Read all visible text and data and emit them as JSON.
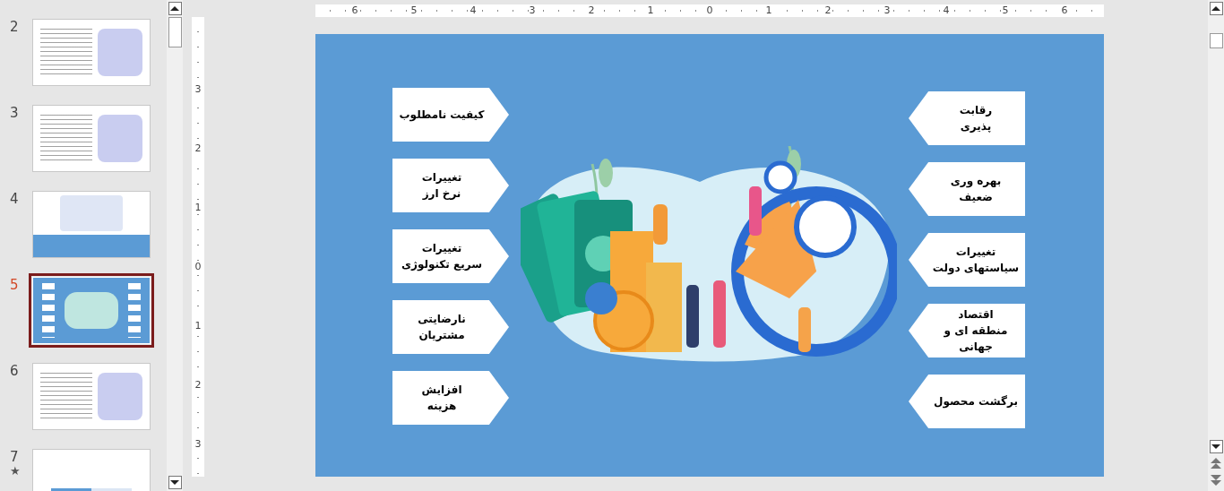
{
  "slide_panel": {
    "slides": [
      {
        "number": "2",
        "kind": "plain",
        "selected": false
      },
      {
        "number": "3",
        "kind": "plain",
        "selected": false
      },
      {
        "number": "4",
        "kind": "banner",
        "selected": false
      },
      {
        "number": "5",
        "kind": "blue",
        "selected": true
      },
      {
        "number": "6",
        "kind": "plain",
        "selected": false
      },
      {
        "number": "7",
        "kind": "header",
        "selected": false,
        "animation_mark": "★"
      }
    ]
  },
  "horizontal_ruler": {
    "labels": [
      "6",
      "5",
      "4",
      "3",
      "2",
      "1",
      "0",
      "1",
      "2",
      "3",
      "4",
      "5",
      "6"
    ]
  },
  "vertical_ruler": {
    "labels": [
      "3",
      "2",
      "1",
      "0",
      "1",
      "2",
      "3"
    ]
  },
  "slide": {
    "left_arrows": [
      {
        "lines": [
          "کیفیت نامطلوب"
        ]
      },
      {
        "lines": [
          "تغییرات",
          "نرخ ارز"
        ]
      },
      {
        "lines": [
          "تغییرات",
          "سریع تکنولوژی"
        ]
      },
      {
        "lines": [
          "نارضایتی",
          "مشتریان"
        ]
      },
      {
        "lines": [
          "افزایش",
          "هزینه"
        ]
      }
    ],
    "right_arrows": [
      {
        "lines": [
          "رقابت",
          "پذیری"
        ]
      },
      {
        "lines": [
          "بهره وری",
          "ضعیف"
        ]
      },
      {
        "lines": [
          "تغییرات",
          "سیاستهای دولت"
        ]
      },
      {
        "lines": [
          "اقتصاد",
          "منطقه ای و",
          "جهانی"
        ]
      },
      {
        "lines": [
          "برگشت محصول"
        ]
      }
    ]
  }
}
